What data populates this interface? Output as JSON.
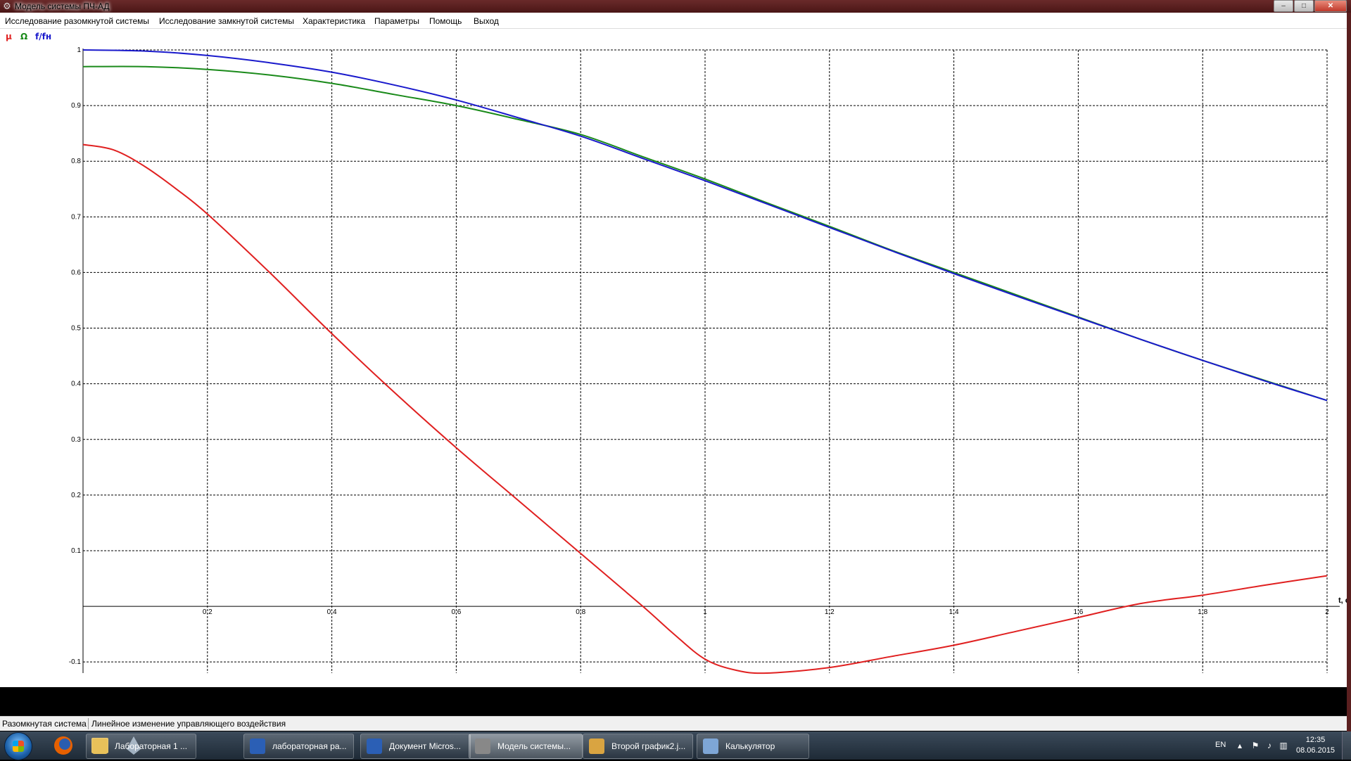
{
  "window": {
    "title": "Модель системы ПЧ-АД"
  },
  "title_buttons": {
    "minimize": "‒",
    "maximize": "□",
    "close": "✕"
  },
  "menu": [
    "Исследование разомкнутой системы",
    "Исследование замкнутой системы",
    "Характеристика",
    "Параметры",
    "Помощь",
    "Выход"
  ],
  "legend": [
    {
      "label": "μ",
      "color": "#e02020"
    },
    {
      "label": "Ω",
      "color": "#1a8a1a"
    },
    {
      "label": "f/fн",
      "color": "#1a1acc"
    }
  ],
  "chart_data": {
    "type": "line",
    "xlabel": "t, c",
    "ylabel": "",
    "xlim": [
      0,
      2
    ],
    "ylim": [
      -0.12,
      1
    ],
    "grid": true,
    "x_ticks": [
      0.2,
      0.4,
      0.6,
      0.8,
      1,
      1.2,
      1.4,
      1.6,
      1.8,
      2
    ],
    "y_ticks": [
      1,
      0.9,
      0.8,
      0.7,
      0.6,
      0.5,
      0.4,
      0.3,
      0.2,
      0.1,
      -0.1
    ],
    "x_tick_labels": [
      "0.2",
      "0.4",
      "0.6",
      "0.8",
      "1",
      "1.2",
      "1.4",
      "1.6",
      "1.8",
      "2"
    ],
    "y_tick_labels": [
      "1",
      "0.9",
      "0.8",
      "0.7",
      "0.6",
      "0.5",
      "0.4",
      "0.3",
      "0.2",
      "0.1",
      "-0.1"
    ],
    "series": [
      {
        "name": "μ",
        "color": "#e02020",
        "x": [
          0,
          0.05,
          0.1,
          0.15,
          0.2,
          0.3,
          0.4,
          0.5,
          0.6,
          0.7,
          0.8,
          0.9,
          0.95,
          1.0,
          1.05,
          1.1,
          1.2,
          1.3,
          1.4,
          1.5,
          1.6,
          1.7,
          1.8,
          1.9,
          2.0
        ],
        "values": [
          0.83,
          0.82,
          0.79,
          0.75,
          0.705,
          0.6,
          0.49,
          0.385,
          0.285,
          0.19,
          0.095,
          0.0,
          -0.05,
          -0.095,
          -0.115,
          -0.12,
          -0.11,
          -0.09,
          -0.07,
          -0.045,
          -0.02,
          0.005,
          0.02,
          0.038,
          0.055
        ]
      },
      {
        "name": "Ω",
        "color": "#1a8a1a",
        "x": [
          0,
          0.1,
          0.2,
          0.3,
          0.4,
          0.5,
          0.6,
          0.7,
          0.8,
          0.9,
          1.0,
          1.1,
          1.2,
          1.3,
          1.4,
          1.5,
          1.6,
          1.7,
          1.8,
          1.9,
          2.0
        ],
        "values": [
          0.97,
          0.97,
          0.965,
          0.955,
          0.94,
          0.92,
          0.9,
          0.875,
          0.848,
          0.808,
          0.768,
          0.725,
          0.683,
          0.64,
          0.6,
          0.56,
          0.52,
          0.48,
          0.442,
          0.406,
          0.37
        ]
      },
      {
        "name": "f/fн",
        "color": "#1a1acc",
        "x": [
          0,
          0.1,
          0.2,
          0.3,
          0.4,
          0.5,
          0.6,
          0.7,
          0.8,
          0.9,
          1.0,
          1.1,
          1.2,
          1.3,
          1.4,
          1.5,
          1.6,
          1.7,
          1.8,
          1.9,
          2.0
        ],
        "values": [
          1.0,
          0.998,
          0.99,
          0.977,
          0.96,
          0.937,
          0.91,
          0.878,
          0.845,
          0.805,
          0.765,
          0.723,
          0.681,
          0.639,
          0.598,
          0.558,
          0.519,
          0.48,
          0.442,
          0.405,
          0.37
        ]
      }
    ]
  },
  "statusbar": {
    "left": "Разомкнутая система",
    "right": "Линейное изменение управляющего воздействия"
  },
  "taskbar": {
    "buttons": [
      {
        "label": "Лабораторная 1 ...",
        "icon": "folder-icon",
        "color": "#e8c15a",
        "active": false
      },
      {
        "label": "лабораторная ра...",
        "icon": "word-icon",
        "color": "#2b5fb5",
        "active": false
      },
      {
        "label": "Документ Micros...",
        "icon": "word-icon",
        "color": "#2b5fb5",
        "active": false
      },
      {
        "label": "Модель системы...",
        "icon": "gear-icon",
        "color": "#888888",
        "active": true
      },
      {
        "label": "Второй график2.j...",
        "icon": "paint-icon",
        "color": "#d9a441",
        "active": false
      },
      {
        "label": "Калькулятор",
        "icon": "calculator-icon",
        "color": "#7ea6d6",
        "active": false
      }
    ],
    "tray": {
      "lang": "EN",
      "time": "12:35",
      "date": "08.06.2015"
    }
  }
}
